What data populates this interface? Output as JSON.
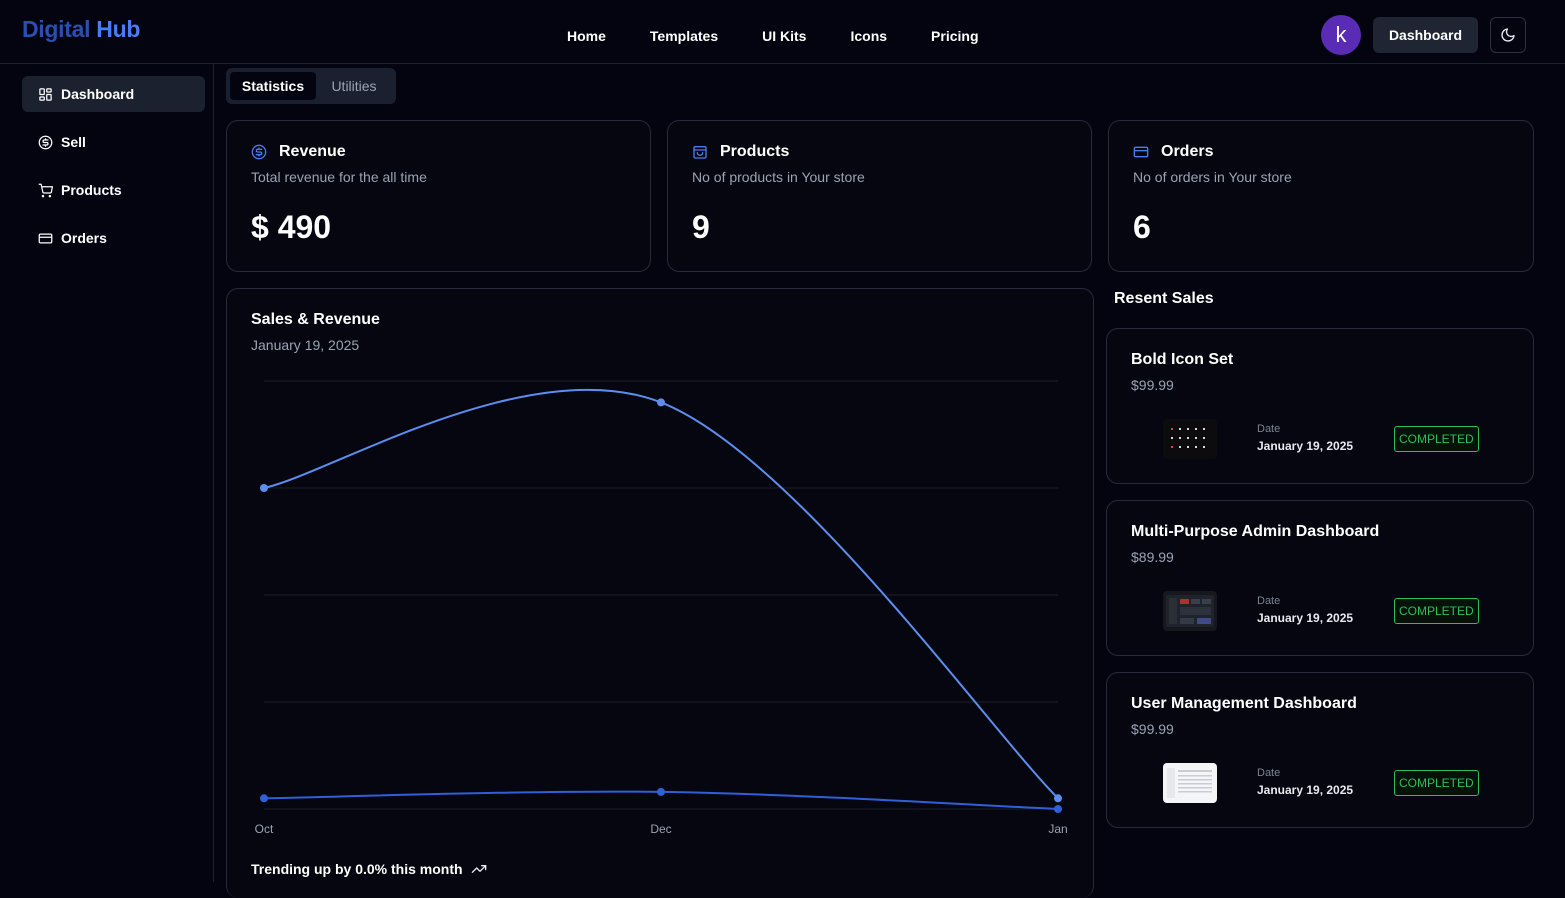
{
  "brand": {
    "part1": "Digital",
    "part2": "Hub"
  },
  "nav": [
    "Home",
    "Templates",
    "UI Kits",
    "Icons",
    "Pricing"
  ],
  "user": {
    "avatar_letter": "k"
  },
  "header": {
    "dashboard_label": "Dashboard"
  },
  "sidebar": {
    "items": [
      {
        "label": "Dashboard",
        "icon": "dashboard-grid-icon"
      },
      {
        "label": "Sell",
        "icon": "dollar-circle-icon"
      },
      {
        "label": "Products",
        "icon": "cart-icon"
      },
      {
        "label": "Orders",
        "icon": "card-icon"
      }
    ]
  },
  "tabs": [
    "Statistics",
    "Utilities"
  ],
  "stats": [
    {
      "title": "Revenue",
      "subtitle": "Total revenue for the all time",
      "value": "$ 490",
      "icon": "dollar-circle-icon"
    },
    {
      "title": "Products",
      "subtitle": "No of products in Your store",
      "value": "9",
      "icon": "bag-icon"
    },
    {
      "title": "Orders",
      "subtitle": "No of orders in Your store",
      "value": "6",
      "icon": "card-icon"
    }
  ],
  "chart": {
    "title": "Sales & Revenue",
    "date": "January 19, 2025",
    "trend": "Trending up by 0.0% this month"
  },
  "chart_data": {
    "type": "line",
    "categories": [
      "Oct",
      "Dec",
      "Jan"
    ],
    "series": [
      {
        "values": [
          300,
          380,
          10
        ],
        "color": "#5b8ef0"
      },
      {
        "values": [
          10,
          16,
          0
        ],
        "color": "#2f5fd9"
      }
    ],
    "ylim": [
      0,
      400
    ],
    "grid": true
  },
  "recent": {
    "heading": "Resent Sales",
    "date_label": "Date",
    "items": [
      {
        "name": "Bold Icon Set",
        "price": "$99.99",
        "date": "January 19, 2025",
        "status": "COMPLETED"
      },
      {
        "name": "Multi-Purpose Admin Dashboard",
        "price": "$89.99",
        "date": "January 19, 2025",
        "status": "COMPLETED"
      },
      {
        "name": "User Management Dashboard",
        "price": "$99.99",
        "date": "January 19, 2025",
        "status": "COMPLETED"
      }
    ]
  }
}
